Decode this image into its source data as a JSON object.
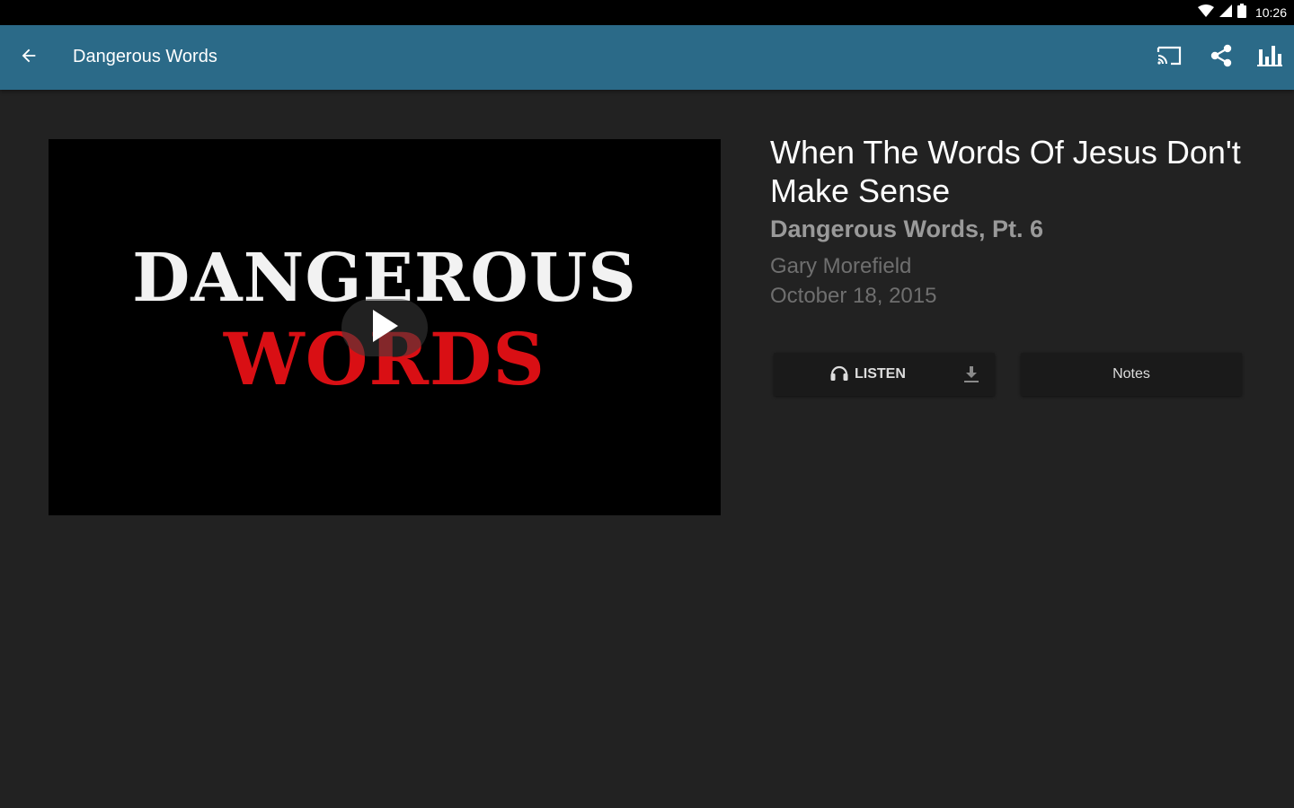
{
  "status_bar": {
    "time": "10:26",
    "icons": [
      "wifi-icon",
      "signal-icon",
      "battery-icon"
    ]
  },
  "app_bar": {
    "title": "Dangerous Words",
    "color": "#2b6a88",
    "back_icon": "arrow-back-icon",
    "actions": [
      "cast-icon",
      "share-icon",
      "bar-chart-icon"
    ]
  },
  "video": {
    "artwork_line1": "DANGEROUS",
    "artwork_line2": "WORDS",
    "artwork_line2_color": "#d90f14",
    "play_icon": "play-icon"
  },
  "sermon": {
    "title": "When The Words Of Jesus Don't Make Sense",
    "series": "Dangerous Words, Pt. 6",
    "speaker": "Gary Morefield",
    "date": "October 18, 2015"
  },
  "buttons": {
    "listen_label": "LISTEN",
    "listen_icon": "headphones-icon",
    "download_icon": "download-icon",
    "notes_label": "Notes"
  }
}
